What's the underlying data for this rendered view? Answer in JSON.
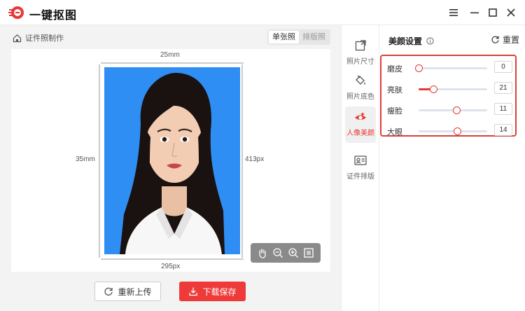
{
  "app": {
    "title": "一键抠图"
  },
  "breadcrumb": {
    "label": "证件照制作"
  },
  "view_toggle": {
    "single": "单张照",
    "layout": "排版照"
  },
  "canvas": {
    "dim_top": "25mm",
    "dim_left": "35mm",
    "dim_right": "413px",
    "dim_bottom": "295px",
    "background_color": "#2f8ef3"
  },
  "zoom_toolbar": [
    "hand-icon",
    "zoom-out-icon",
    "zoom-in-icon",
    "fit-icon"
  ],
  "actions": {
    "retry": "重新上传",
    "save": "下载保存"
  },
  "tools": [
    {
      "label": "照片尺寸",
      "icon": "crop-icon"
    },
    {
      "label": "照片底色",
      "icon": "paint-bucket-icon"
    },
    {
      "label": "人像美颜",
      "icon": "eye-beauty-icon",
      "active": true
    },
    {
      "label": "证件排版",
      "icon": "id-card-icon"
    }
  ],
  "settings": {
    "title": "美颜设置",
    "reset": "重置",
    "adjustments": [
      {
        "name": "磨皮",
        "value": "0",
        "fraction": 0.0
      },
      {
        "name": "亮肤",
        "value": "21",
        "fraction": 0.21
      },
      {
        "name": "瘦脸",
        "value": "11",
        "fraction": 0.55
      },
      {
        "name": "大眼",
        "value": "14",
        "fraction": 0.56
      }
    ]
  },
  "colors": {
    "accent": "#e53935",
    "photo_bg": "#2f8ef3"
  }
}
